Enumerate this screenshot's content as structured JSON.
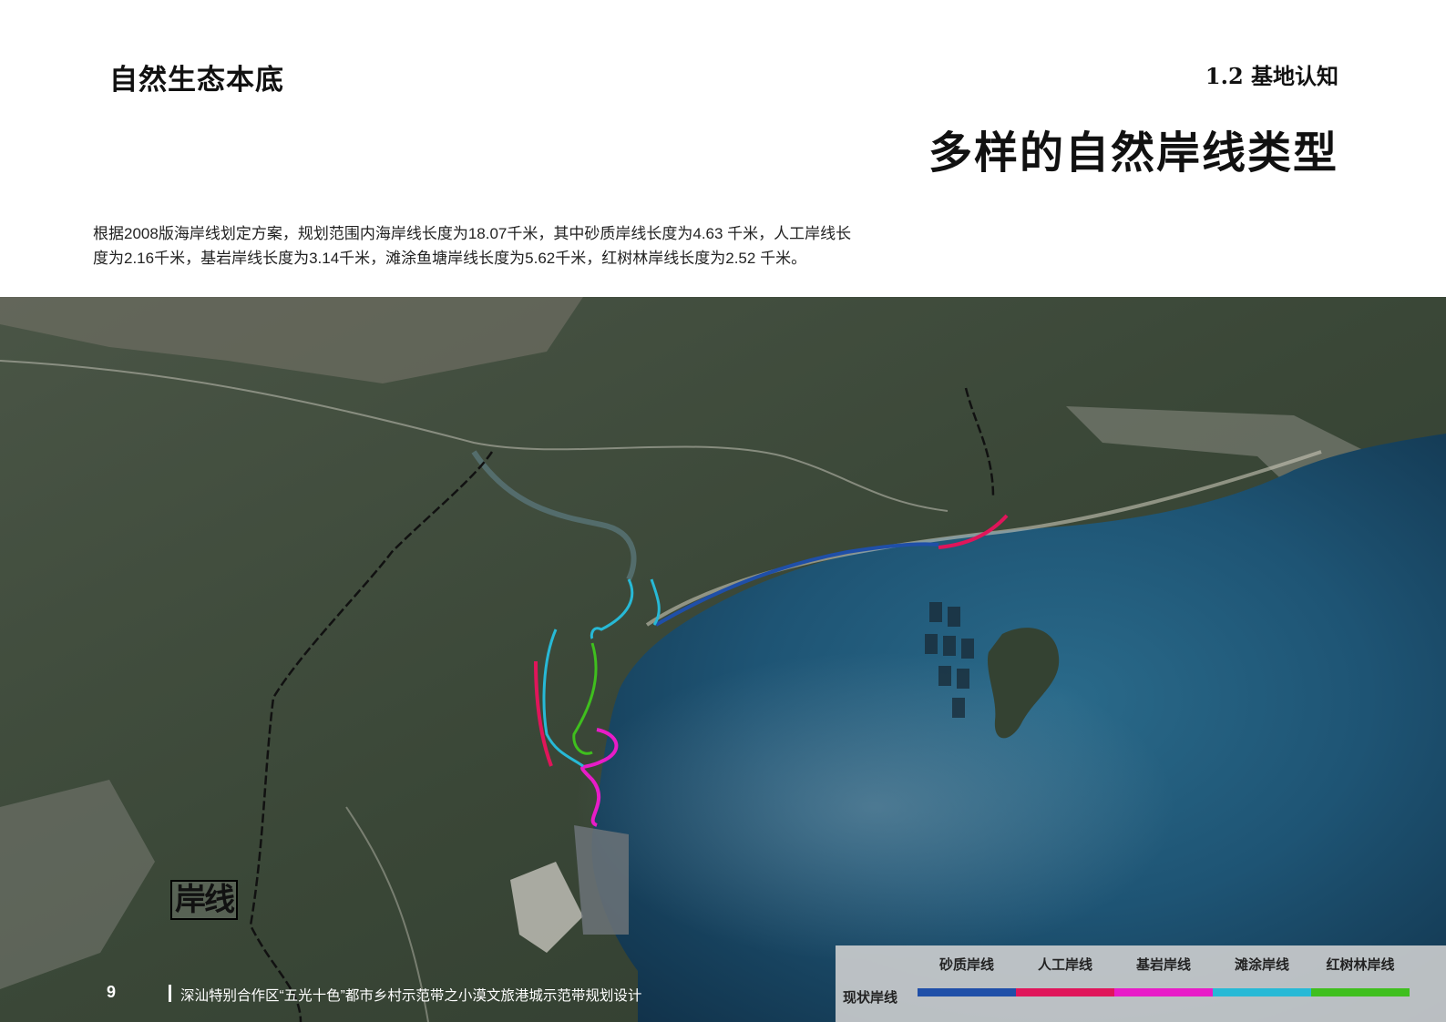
{
  "header": {
    "section_title": "自然生态本底",
    "section_number": "1.2 基地认知",
    "page_heading": "多样的自然岸线类型"
  },
  "intro": {
    "line1": "根据2008版海岸线划定方案，规划范围内海岸线长度为18.07千米，其中砂质岸线长度为4.63 千米，人工岸线长",
    "line2": "度为2.16千米，基岩岸线长度为3.14千米，滩涂鱼塘岸线长度为5.62千米，红树林岸线长度为2.52 千米。"
  },
  "map": {
    "stamp": "岸线",
    "colors": {
      "sea_deep": "#153a5a",
      "sea_mid": "#1f5778",
      "land": "#3e4b3b",
      "boundary": "#111111"
    }
  },
  "footer": {
    "page_number": "9",
    "text": "深汕特别合作区“五光十色”都市乡村示范带之小漠文旅港城示范带规划设计"
  },
  "legend": {
    "title": "现状岸线",
    "items": [
      {
        "label": "砂质岸线",
        "color": "#1f4fa8"
      },
      {
        "label": "人工岸线",
        "color": "#e0155a"
      },
      {
        "label": "基岩岸线",
        "color": "#e81cc8"
      },
      {
        "label": "滩涂岸线",
        "color": "#27b9d6"
      },
      {
        "label": "红树林岸线",
        "color": "#3fbf1e"
      }
    ]
  }
}
